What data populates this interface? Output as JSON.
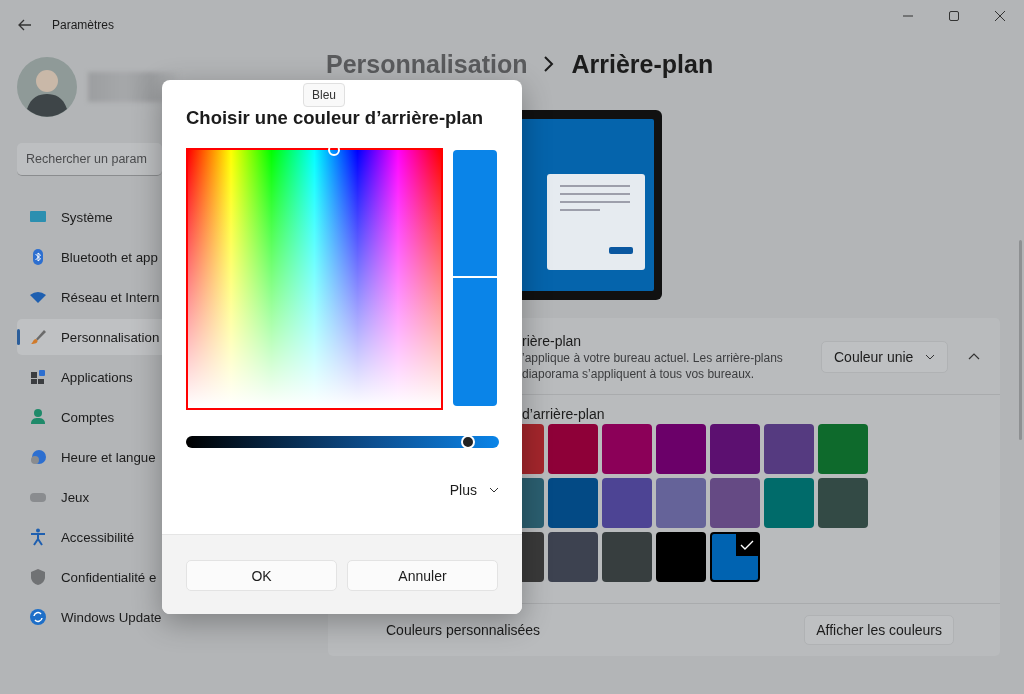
{
  "window": {
    "title": "Paramètres"
  },
  "sidebar": {
    "search": {
      "placeholder": "Rechercher un param"
    },
    "items": [
      {
        "label": "Système",
        "selected": false
      },
      {
        "label": "Bluetooth et app",
        "selected": false
      },
      {
        "label": "Réseau et Intern",
        "selected": false
      },
      {
        "label": "Personnalisation",
        "selected": true
      },
      {
        "label": "Applications",
        "selected": false
      },
      {
        "label": "Comptes",
        "selected": false
      },
      {
        "label": "Heure et langue",
        "selected": false
      },
      {
        "label": "Jeux",
        "selected": false
      },
      {
        "label": "Accessibilité",
        "selected": false
      },
      {
        "label": "Confidentialité e",
        "selected": false
      },
      {
        "label": "Windows Update",
        "selected": false
      }
    ]
  },
  "header": {
    "parent": "Personnalisation",
    "current": "Arrière-plan"
  },
  "background_card": {
    "title": "rière-plan",
    "description": [
      "’applique à votre bureau actuel. Les arrière-plans",
      "diaporama s’appliquent à tous vos bureaux."
    ],
    "dropdown": "Couleur unie",
    "expanded": true,
    "colors_label": "d’arrière-plan",
    "swatches": [
      {
        "color": "#a4262c",
        "selected": false
      },
      {
        "color": "#8e0038",
        "selected": false
      },
      {
        "color": "#8b0058",
        "selected": false
      },
      {
        "color": "#6b0069",
        "selected": false
      },
      {
        "color": "#5c1070",
        "selected": false
      },
      {
        "color": "#553a80",
        "selected": false
      },
      {
        "color": "#0e6a2c",
        "selected": false
      },
      {
        "color": "#2b5f70",
        "selected": false
      },
      {
        "color": "#034a85",
        "selected": false
      },
      {
        "color": "#4d4494",
        "selected": false
      },
      {
        "color": "#656399",
        "selected": false
      },
      {
        "color": "#654a84",
        "selected": false
      },
      {
        "color": "#006b6a",
        "selected": false
      },
      {
        "color": "#334a45",
        "selected": false
      },
      {
        "color": "#3a3a3a",
        "selected": false
      },
      {
        "color": "#3d4250",
        "selected": false
      },
      {
        "color": "#373e3f",
        "selected": false
      },
      {
        "color": "#000000",
        "selected": false
      },
      {
        "color": "#0063b1",
        "selected": true
      }
    ],
    "custom_colors_label": "Couleurs personnalisées",
    "view_colors_button": "Afficher les couleurs"
  },
  "dialog": {
    "title": "Choisir une couleur d’arrière-plan",
    "tooltip": "Bleu",
    "brightness": {
      "level": 0.9
    },
    "more": "Plus",
    "ok": "OK",
    "cancel": "Annuler"
  }
}
